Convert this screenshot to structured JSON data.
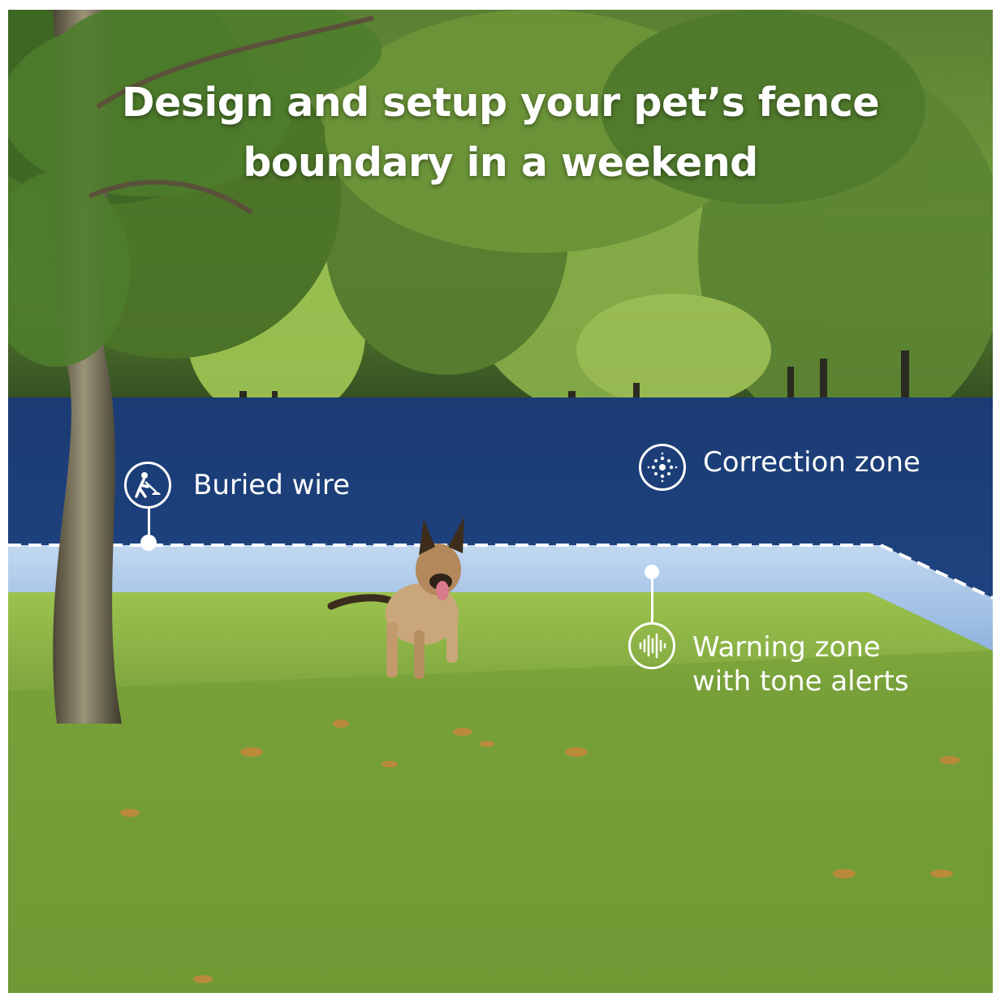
{
  "headline": {
    "line1": "Design and setup your pet’s fence",
    "line2": "boundary in a weekend"
  },
  "callouts": {
    "buried_wire": {
      "label": "Buried wire",
      "icon": "digging-person-icon"
    },
    "correction_zone": {
      "label": "Correction zone",
      "icon": "radiating-pulse-icon"
    },
    "warning_zone": {
      "line1": "Warning zone",
      "line2": "with tone alerts",
      "icon": "sound-wave-icon"
    }
  },
  "colors": {
    "correction_zone": "#1c3f7a",
    "warning_zone": "#a9c8ea",
    "boundary_line": "#ffffff",
    "grass": "#7aa43c",
    "foliage": "#3f6a22"
  }
}
